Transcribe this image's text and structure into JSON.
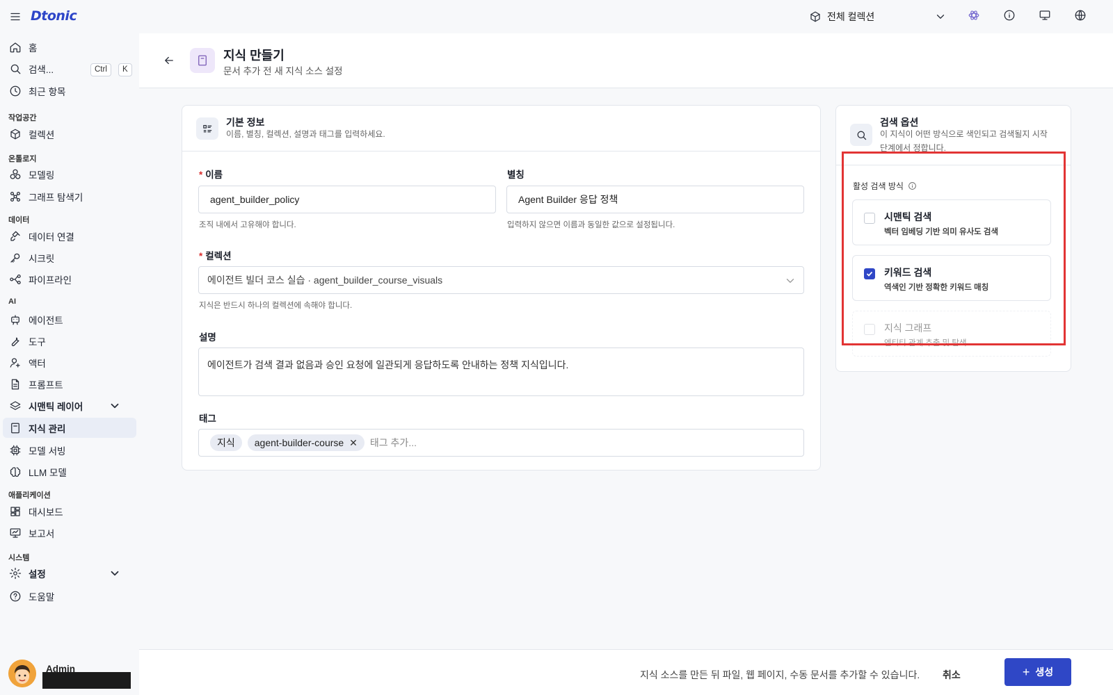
{
  "app": {
    "logo": "Dtonic"
  },
  "topbar": {
    "collection_selector": "전체 컬렉션"
  },
  "sidebar": {
    "home": "홈",
    "search": "검색...",
    "shortcut_ctrl": "Ctrl",
    "shortcut_k": "K",
    "recent": "최근 항목",
    "sections": {
      "workspace": "작업공간",
      "ontology": "온톨로지",
      "data": "데이터",
      "ai": "AI",
      "apps": "애플리케이션",
      "system": "시스템"
    },
    "items": {
      "collection": "컬렉션",
      "modeling": "모델링",
      "graph_explorer": "그래프 탐색기",
      "data_connection": "데이터 연결",
      "secret": "시크릿",
      "pipeline": "파이프라인",
      "agent": "에이전트",
      "tool": "도구",
      "actor": "액터",
      "prompt": "프롬프트",
      "semantic_layer": "시맨틱 레이어",
      "knowledge": "지식 관리",
      "model_serving": "모델 서빙",
      "llm_model": "LLM 모델",
      "dashboard": "대시보드",
      "report": "보고서",
      "settings": "설정",
      "help": "도움말"
    },
    "user": {
      "name": "Admin"
    }
  },
  "header": {
    "title": "지식 만들기",
    "subtitle": "문서 추가 전 새 지식 소스 설정"
  },
  "basic_info": {
    "title": "기본 정보",
    "subtitle": "이름, 별칭, 컬렉션, 설명과 태그를 입력하세요.",
    "name": {
      "label": "이름",
      "value": "agent_builder_policy",
      "help": "조직 내에서 고유해야 합니다."
    },
    "alias": {
      "label": "별칭",
      "value": "Agent Builder 응답 정책",
      "help": "입력하지 않으면 이름과 동일한 값으로 설정됩니다."
    },
    "collection": {
      "label": "컬렉션",
      "value": "에이전트 빌더 코스 실습 · agent_builder_course_visuals",
      "help": "지식은 반드시 하나의 컬렉션에 속해야 합니다."
    },
    "description": {
      "label": "설명",
      "value": "에이전트가 검색 결과 없음과 승인 요청에 일관되게 응답하도록 안내하는 정책 지식입니다."
    },
    "tags": {
      "label": "태그",
      "items": [
        "지식",
        "agent-builder-course"
      ],
      "placeholder": "태그 추가..."
    }
  },
  "search_options": {
    "title": "검색 옵션",
    "subtitle_line1": "이 지식이 어떤 방식으로 색인되고 검색될지 시작",
    "subtitle_line2": "단계에서 정합니다.",
    "active_label": "활성 검색 방식",
    "options": [
      {
        "title": "시맨틱 검색",
        "desc": "벡터 임베딩 기반 의미 유사도 검색",
        "checked": false,
        "disabled": false
      },
      {
        "title": "키워드 검색",
        "desc": "역색인 기반 정확한 키워드 매칭",
        "checked": true,
        "disabled": false
      },
      {
        "title": "지식 그래프",
        "desc": "엔티티 관계 추출 및 탐색",
        "checked": false,
        "disabled": true
      }
    ]
  },
  "footer": {
    "note": "지식 소스를 만든 뒤 파일, 웹 페이지, 수동 문서를 추가할 수 있습니다.",
    "cancel": "취소",
    "create": "생성"
  },
  "colors": {
    "accent": "#2f47c6",
    "highlight_box": "#e23434",
    "required": "#d92c2c"
  }
}
